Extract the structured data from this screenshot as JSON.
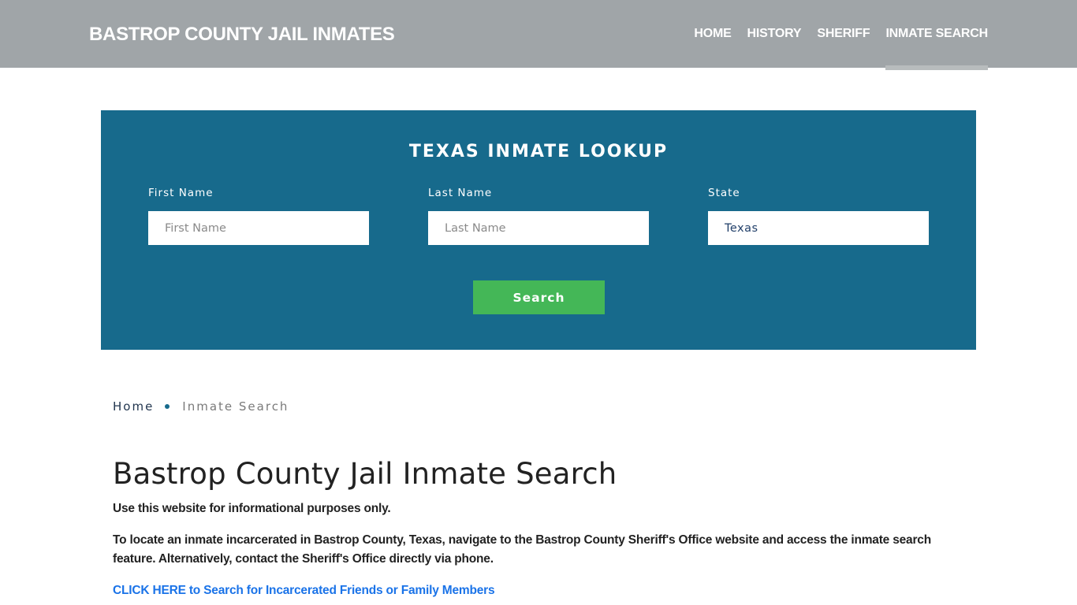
{
  "header": {
    "brand": "BASTROP COUNTY JAIL INMATES",
    "nav": [
      {
        "label": "HOME",
        "active": false
      },
      {
        "label": "HISTORY",
        "active": false
      },
      {
        "label": "SHERIFF",
        "active": false
      },
      {
        "label": "INMATE SEARCH",
        "active": true
      }
    ]
  },
  "lookup": {
    "title": "TEXAS INMATE LOOKUP",
    "fields": [
      {
        "label": "First Name",
        "placeholder": "First Name",
        "value": ""
      },
      {
        "label": "Last Name",
        "placeholder": "Last Name",
        "value": ""
      },
      {
        "label": "State",
        "placeholder": "",
        "value": "Texas"
      }
    ],
    "search_label": "Search"
  },
  "breadcrumb": {
    "home": "Home",
    "current": "Inmate Search"
  },
  "main": {
    "title": "Bastrop County Jail Inmate Search",
    "paragraphs": [
      "Use this website for informational purposes only.",
      "To locate an inmate incarcerated in Bastrop County, Texas, navigate to the Bastrop County Sheriff's Office website and access the inmate search feature. Alternatively, contact the Sheriff's Office directly via phone."
    ],
    "cta_link": "CLICK HERE to Search for Incarcerated Friends or Family Members"
  },
  "colors": {
    "header_bg": "#a0a5a8",
    "lookup_bg": "#176a8c",
    "search_button": "#44b757",
    "link": "#1a73e8"
  }
}
